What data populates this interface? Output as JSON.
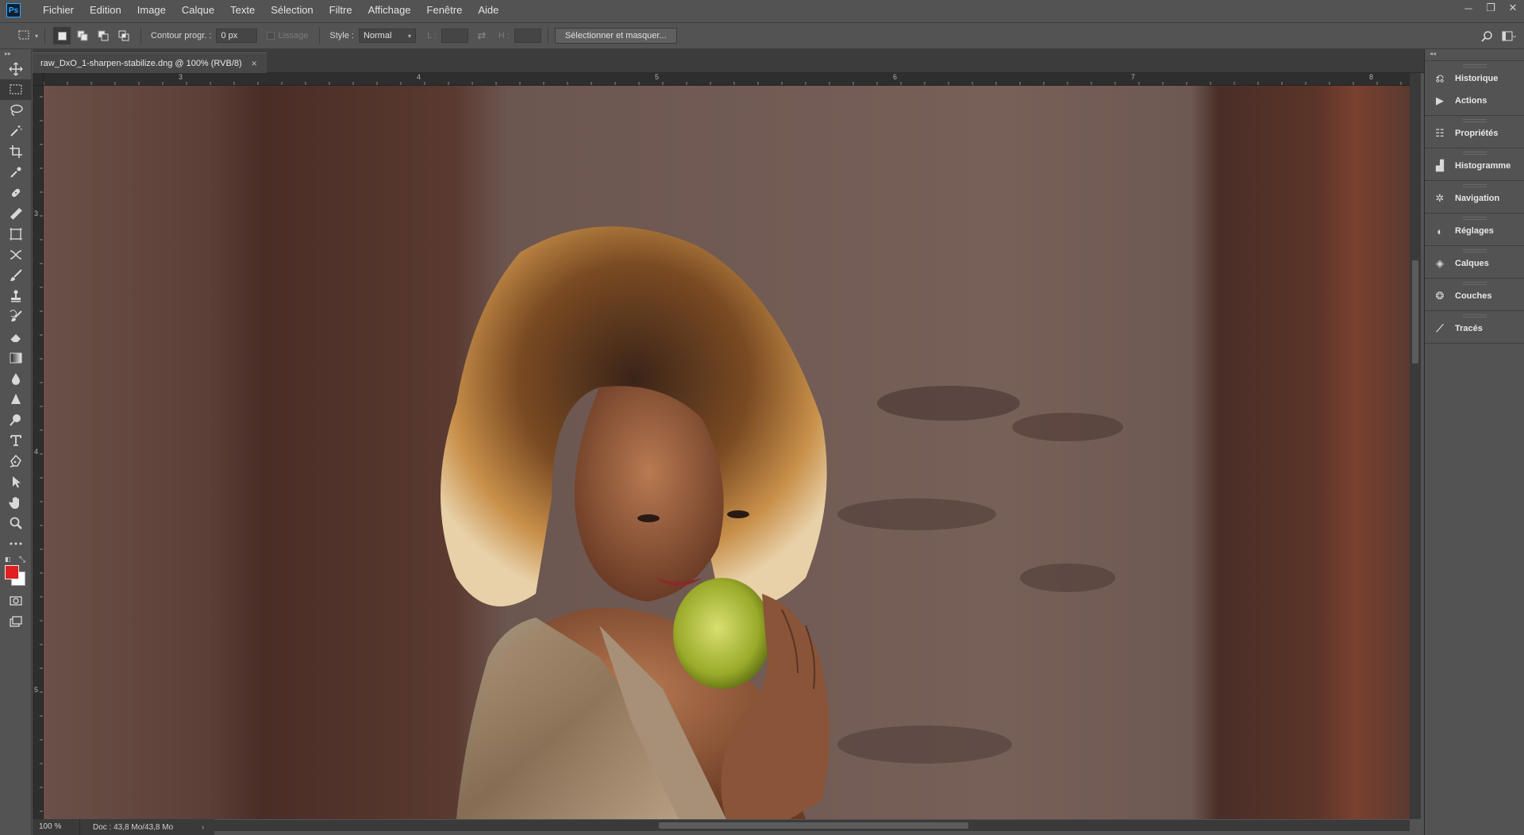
{
  "app": {
    "logo": "Ps",
    "menu": [
      "Fichier",
      "Edition",
      "Image",
      "Calque",
      "Texte",
      "Sélection",
      "Filtre",
      "Affichage",
      "Fenêtre",
      "Aide"
    ],
    "window_controls": [
      "minimize-icon",
      "restore-icon",
      "close-icon"
    ]
  },
  "options": {
    "feather_label": "Contour progr. :",
    "feather_value": "0 px",
    "antialias_label": "Lissage",
    "style_label": "Style :",
    "style_value": "Normal",
    "width_label": "L :",
    "height_label": "H :",
    "select_mask_label": "Sélectionner et masquer..."
  },
  "document": {
    "tab_title": "raw_DxO_1-sharpen-stabilize.dng @ 100% (RVB/8)",
    "close_glyph": "×"
  },
  "rulers": {
    "top_labels": [
      "3",
      "4",
      "5",
      "6",
      "7",
      "8"
    ],
    "left_labels": [
      "3",
      "4",
      "5"
    ]
  },
  "colors": {
    "foreground": "#e02020",
    "background": "#ffffff",
    "accent": "#31a8ff"
  },
  "status": {
    "zoom": "100 %",
    "doc_size": "Doc : 43,8 Mo/43,8 Mo",
    "arrow": "›"
  },
  "panels": [
    {
      "items": [
        {
          "label": "Historique",
          "icon": "history-icon",
          "glyph": "⎌"
        },
        {
          "label": "Actions",
          "icon": "actions-play-icon",
          "glyph": "▶"
        }
      ]
    },
    {
      "items": [
        {
          "label": "Propriétés",
          "icon": "properties-icon",
          "glyph": "☷"
        }
      ]
    },
    {
      "items": [
        {
          "label": "Histogramme",
          "icon": "histogram-icon",
          "glyph": "▟"
        }
      ]
    },
    {
      "items": [
        {
          "label": "Navigation",
          "icon": "navigator-icon",
          "glyph": "✲"
        }
      ]
    },
    {
      "items": [
        {
          "label": "Réglages",
          "icon": "adjustments-icon",
          "glyph": "◐"
        }
      ]
    },
    {
      "items": [
        {
          "label": "Calques",
          "icon": "layers-icon",
          "glyph": "◈"
        }
      ]
    },
    {
      "items": [
        {
          "label": "Couches",
          "icon": "channels-icon",
          "glyph": "❂"
        }
      ]
    },
    {
      "items": [
        {
          "label": "Tracés",
          "icon": "paths-icon",
          "glyph": "⟋"
        }
      ]
    }
  ],
  "tools": [
    "move-tool-icon",
    "marquee-tool-icon",
    "lasso-tool-icon",
    "magic-wand-tool-icon",
    "crop-tool-icon",
    "eyedropper-tool-icon",
    "healing-brush-tool-icon",
    "ruler-tool-icon",
    "frame-tool-icon",
    "puppet-warp-tool-icon",
    "brush-tool-icon",
    "clone-stamp-tool-icon",
    "history-brush-tool-icon",
    "eraser-tool-icon",
    "gradient-tool-icon",
    "blur-tool-icon",
    "sharpen-tool-icon",
    "dodge-tool-icon",
    "type-tool-icon",
    "pen-tool-icon",
    "path-selection-tool-icon",
    "hand-tool-icon",
    "zoom-tool-icon",
    "more-tools-icon"
  ]
}
